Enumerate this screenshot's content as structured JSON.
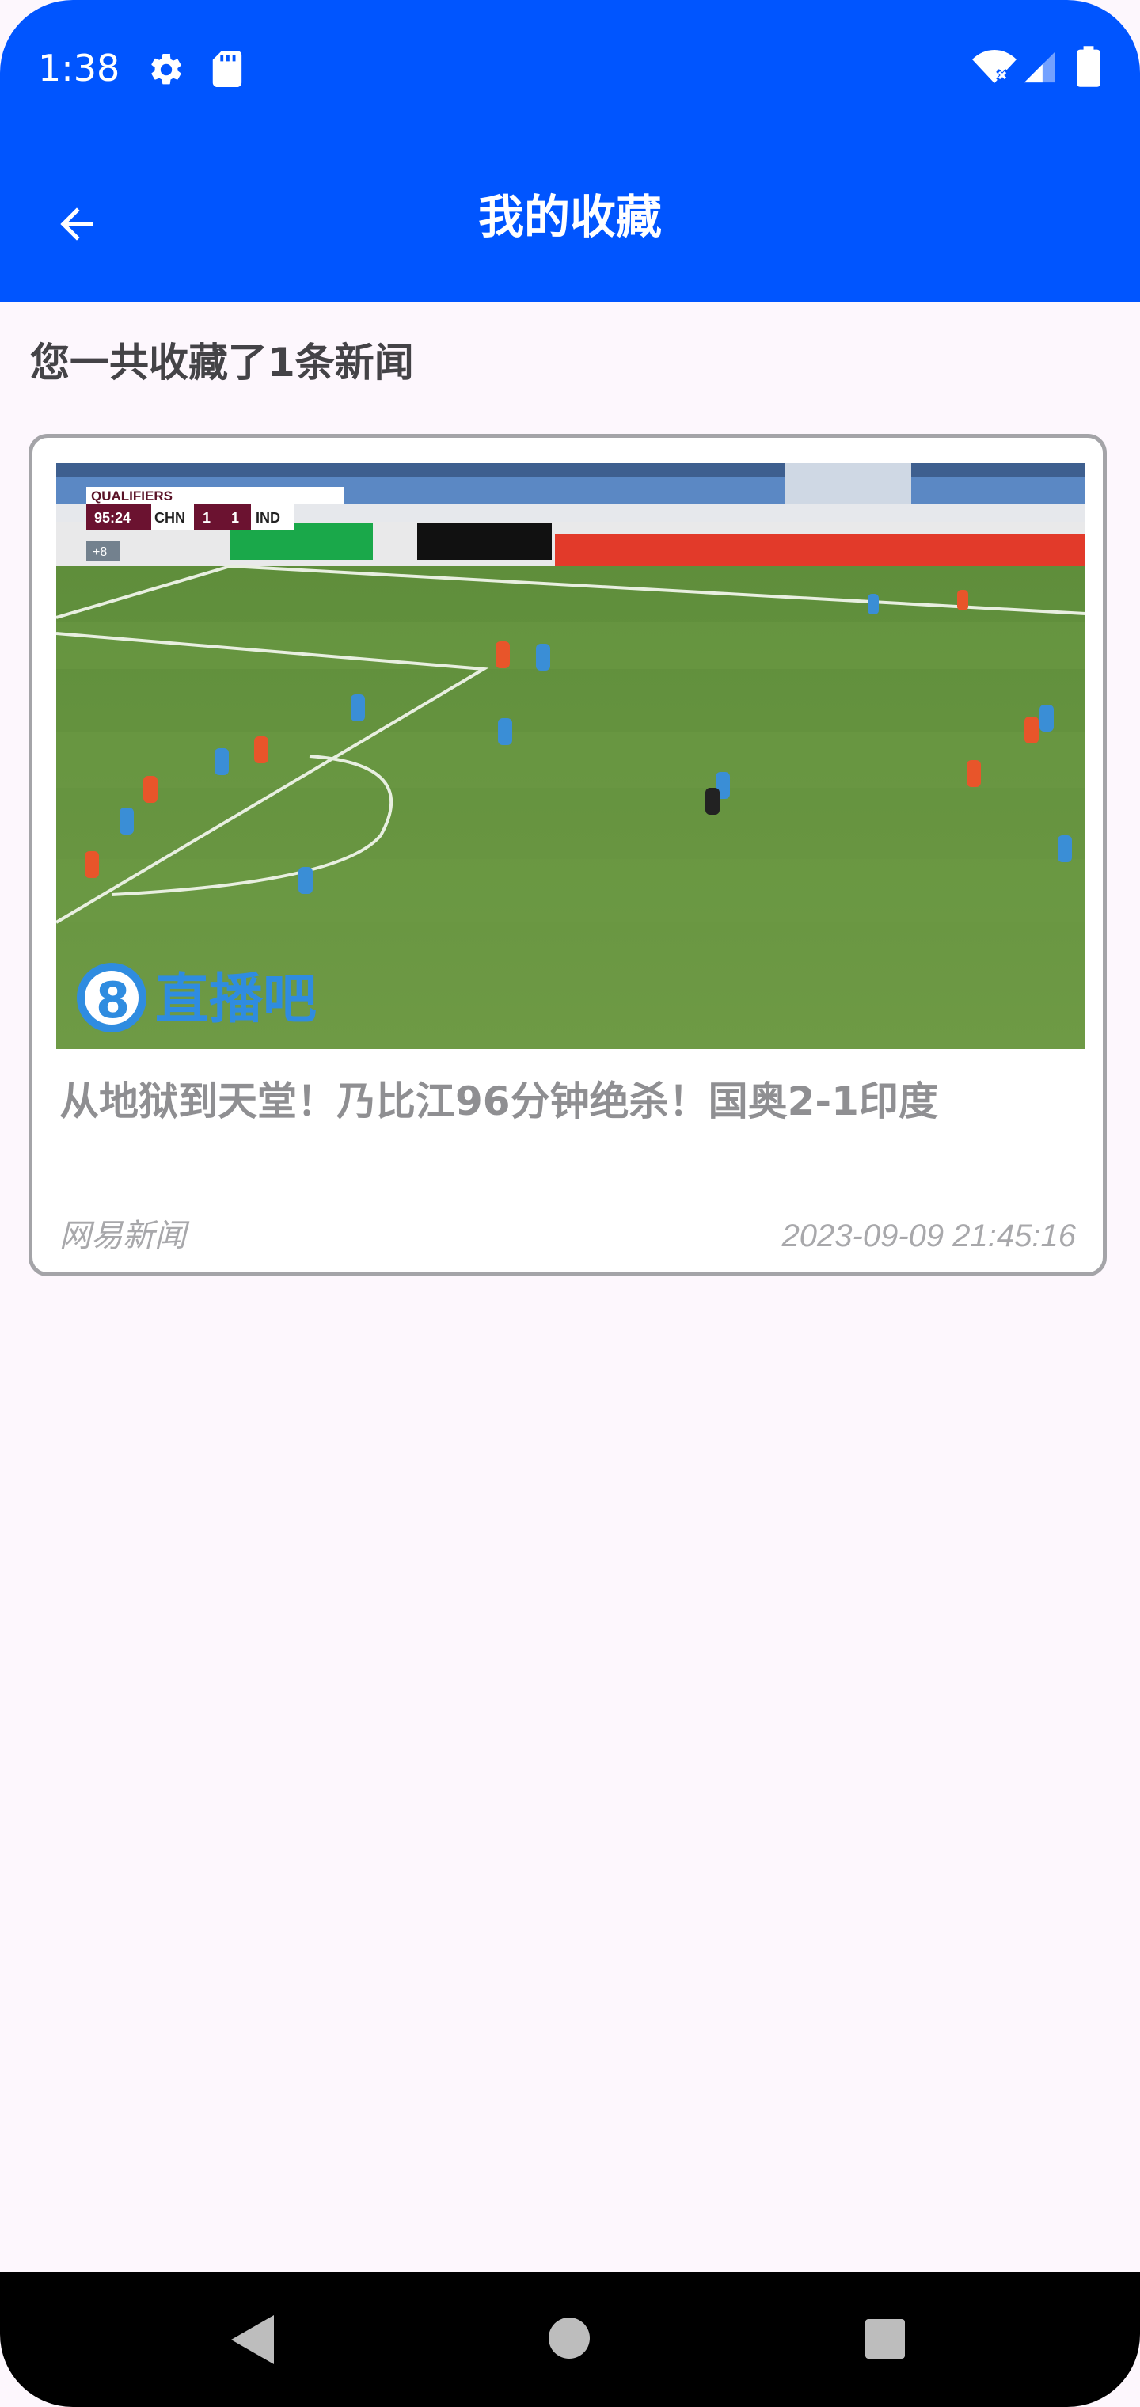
{
  "status_bar": {
    "time": "1:38",
    "icons": [
      "settings-icon",
      "sd-card-icon",
      "wifi-icon",
      "signal-icon",
      "battery-icon"
    ]
  },
  "app_bar": {
    "title": "我的收藏",
    "back_icon": "arrow-back-icon",
    "background_color": "#0055ff"
  },
  "summary": {
    "text": "您一共收藏了1条新闻"
  },
  "favorites": [
    {
      "title": "从地狱到天堂！乃比江96分钟绝杀！国奥2-1印度",
      "source": "网易新闻",
      "datetime": "2023-09-09 21:45:16",
      "thumbnail": {
        "scoreboard_label": "QUALIFIERS",
        "match_time": "95:24",
        "home_team": "CHN",
        "home_score": "1",
        "away_score": "1",
        "away_team": "IND",
        "added_time": "+8",
        "watermark_digit": "8",
        "watermark_text": "直播吧"
      }
    }
  ],
  "nav_bar": {
    "buttons": [
      "nav-back-button",
      "nav-home-button",
      "nav-recents-button"
    ]
  }
}
